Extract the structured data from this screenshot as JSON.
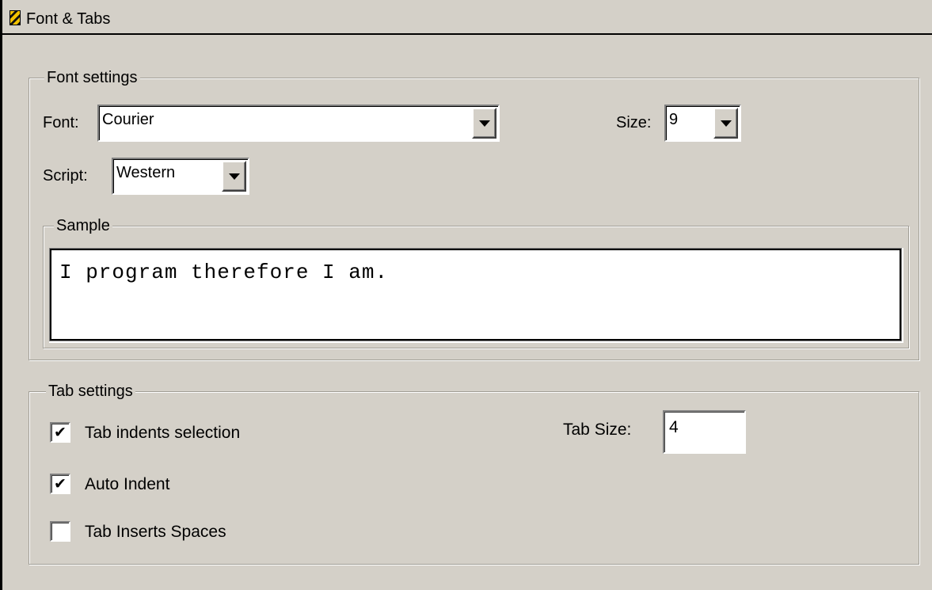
{
  "window": {
    "title": "Font & Tabs",
    "icon": "app-icon"
  },
  "font_settings": {
    "legend": "Font settings",
    "font_label": "Font:",
    "font_value": "Courier",
    "size_label": "Size:",
    "size_value": "9",
    "script_label": "Script:",
    "script_value": "Western",
    "sample_legend": "Sample",
    "sample_text": "I program therefore I am."
  },
  "tab_settings": {
    "legend": "Tab settings",
    "tab_indents_label": "Tab indents selection",
    "tab_indents_checked": true,
    "auto_indent_label": "Auto Indent",
    "auto_indent_checked": true,
    "tab_inserts_spaces_label": "Tab Inserts Spaces",
    "tab_inserts_spaces_checked": false,
    "tab_size_label": "Tab Size:",
    "tab_size_value": "4"
  },
  "check_glyph": "✔"
}
